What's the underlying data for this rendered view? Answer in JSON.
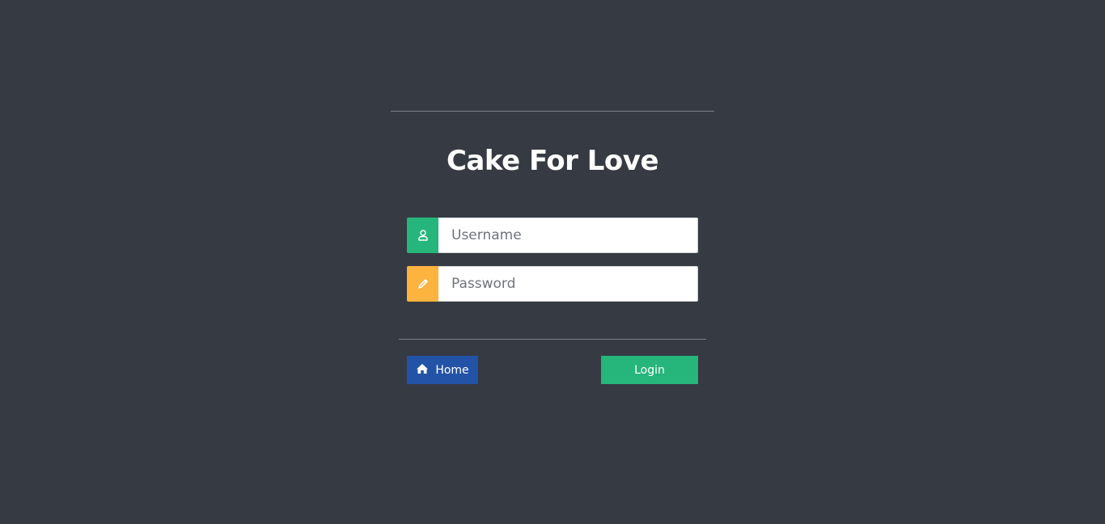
{
  "app": {
    "title": "Cake For Love"
  },
  "form": {
    "username": {
      "placeholder": "Username",
      "value": "",
      "icon": "user-icon"
    },
    "password": {
      "placeholder": "Password",
      "value": "",
      "icon": "pencil-icon"
    }
  },
  "actions": {
    "home_label": "Home",
    "home_icon": "home-icon",
    "login_label": "Login"
  },
  "colors": {
    "background": "#363a43",
    "divider": "#7c8089",
    "username_accent": "#26b57a",
    "password_accent": "#fdb33f",
    "home_button": "#2353a6",
    "login_button": "#26b57a"
  }
}
